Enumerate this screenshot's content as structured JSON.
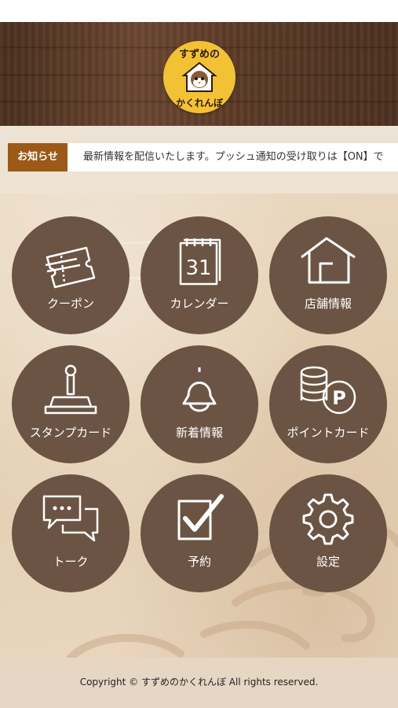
{
  "header": {
    "logo_text_top": "すずめの",
    "logo_text_bottom": "かくれんぼ"
  },
  "news": {
    "label": "お知らせ",
    "text": "最新情報を配信いたします。プッシュ通知の受け取りは【ON】で"
  },
  "menu": [
    {
      "label": "クーポン",
      "icon": "coupon-icon"
    },
    {
      "label": "カレンダー",
      "icon": "calendar-icon",
      "icon_text": "31"
    },
    {
      "label": "店舗情報",
      "icon": "house-icon"
    },
    {
      "label": "スタンプカード",
      "icon": "stamp-icon"
    },
    {
      "label": "新着情報",
      "icon": "bell-icon"
    },
    {
      "label": "ポイントカード",
      "icon": "coins-icon",
      "icon_text": "P"
    },
    {
      "label": "トーク",
      "icon": "chat-icon"
    },
    {
      "label": "予約",
      "icon": "checkbox-icon"
    },
    {
      "label": "設定",
      "icon": "gear-icon"
    }
  ],
  "footer": {
    "copyright": "Copyright © すずめのかくれんぼ All rights reserved."
  },
  "colors": {
    "menu_circle": "#6b5443",
    "news_label_bg": "#9c5a16",
    "logo_bg": "#f3c234"
  }
}
